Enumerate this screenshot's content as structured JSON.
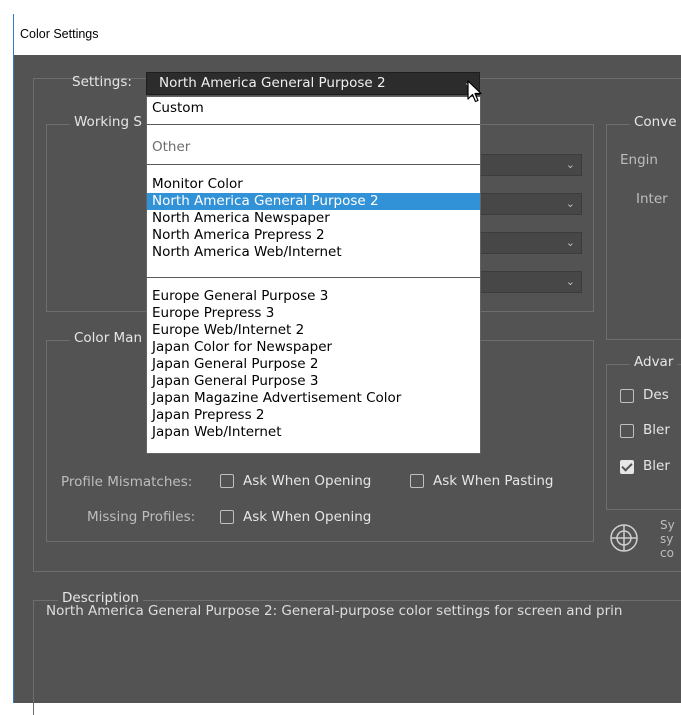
{
  "window": {
    "title": "Color Settings"
  },
  "settings": {
    "label": "Settings:",
    "value": "North America General Purpose 2"
  },
  "working_spaces": {
    "title": "Working S"
  },
  "conversion": {
    "title": "Conve",
    "engine_label": "Engin",
    "intent_label": "Inter"
  },
  "color_management": {
    "title": "Color Man",
    "profile_mismatches_label": "Profile Mismatches:",
    "ask_when_opening_label": "Ask When Opening",
    "ask_when_pasting_label": "Ask When Pasting",
    "missing_profiles_label": "Missing Profiles:",
    "missing_ask_when_opening_label": "Ask When Opening"
  },
  "advanced": {
    "title": "Advar",
    "options": [
      {
        "label": "Des",
        "checked": false
      },
      {
        "label": "Bler",
        "checked": false
      },
      {
        "label": "Bler",
        "checked": true
      }
    ],
    "sync_lines": [
      "Sy",
      "sy",
      "co"
    ]
  },
  "description": {
    "title": "Description",
    "text": "North America General Purpose 2:  General-purpose color settings for screen and prin"
  },
  "dropdown": {
    "items": [
      "Custom",
      "Other",
      "Monitor Color",
      "North America General Purpose 2",
      "North America Newspaper",
      "North America Prepress 2",
      "North America Web/Internet",
      "Europe General Purpose 3",
      "Europe Prepress 3",
      "Europe Web/Internet 2",
      "Japan Color for Newspaper",
      "Japan General Purpose 2",
      "Japan General Purpose 3",
      "Japan Magazine Advertisement Color",
      "Japan Prepress 2",
      "Japan Web/Internet"
    ],
    "selected": "North America General Purpose 2",
    "disabled": [
      "Other"
    ]
  },
  "colors": {
    "panel": "#535353",
    "selection": "#3292d8",
    "window_border": "#2f7ac7"
  },
  "icons": {
    "sync": "globe-icon",
    "cursor": "mouse-pointer-icon",
    "dropdown": "chevron-down-icon"
  }
}
